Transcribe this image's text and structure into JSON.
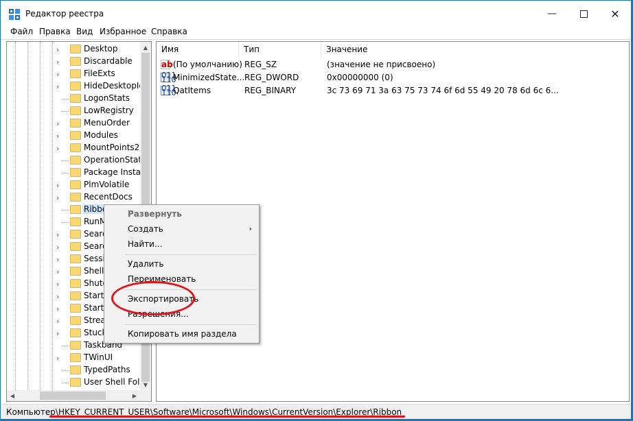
{
  "window": {
    "title": "Редактор реестра"
  },
  "menu": [
    "Файл",
    "Правка",
    "Вид",
    "Избранное",
    "Справка"
  ],
  "tree": {
    "items": [
      {
        "label": "Desktop",
        "expandable": true
      },
      {
        "label": "Discardable",
        "expandable": true
      },
      {
        "label": "FileExts",
        "expandable": true
      },
      {
        "label": "HideDesktopIcc",
        "expandable": true
      },
      {
        "label": "LogonStats",
        "expandable": false
      },
      {
        "label": "LowRegistry",
        "expandable": false
      },
      {
        "label": "MenuOrder",
        "expandable": true
      },
      {
        "label": "Modules",
        "expandable": true
      },
      {
        "label": "MountPoints2",
        "expandable": true
      },
      {
        "label": "OperationStatus",
        "expandable": false
      },
      {
        "label": "Package Installa",
        "expandable": false
      },
      {
        "label": "PlmVolatile",
        "expandable": true
      },
      {
        "label": "RecentDocs",
        "expandable": true
      },
      {
        "label": "Ribbo",
        "expandable": false,
        "selected": true
      },
      {
        "label": "RunM",
        "expandable": false
      },
      {
        "label": "Searc",
        "expandable": true
      },
      {
        "label": "Searc",
        "expandable": true
      },
      {
        "label": "Sessic",
        "expandable": true
      },
      {
        "label": "Shell I",
        "expandable": true
      },
      {
        "label": "Shutd",
        "expandable": true
      },
      {
        "label": "StartP",
        "expandable": true
      },
      {
        "label": "Startu",
        "expandable": true
      },
      {
        "label": "Strear",
        "expandable": true
      },
      {
        "label": "Stuck",
        "expandable": true
      },
      {
        "label": "Taskband",
        "expandable": false
      },
      {
        "label": "TWinUI",
        "expandable": true
      },
      {
        "label": "TypedPaths",
        "expandable": false
      },
      {
        "label": "User Shell Folde",
        "expandable": false
      }
    ]
  },
  "list": {
    "columns": [
      "Имя",
      "Тип",
      "Значение"
    ],
    "rows": [
      {
        "icon": "string-value-icon",
        "name": "(По умолчанию)",
        "type": "REG_SZ",
        "value": "(значение не присвоено)"
      },
      {
        "icon": "binary-value-icon",
        "name": "MinimizedState...",
        "type": "REG_DWORD",
        "value": "0x00000000 (0)"
      },
      {
        "icon": "binary-value-icon",
        "name": "QatItems",
        "type": "REG_BINARY",
        "value": "3c 73 69 71 3a 63 75 73 74 6f 6d 55 49 20 78 6d 6c 6..."
      }
    ]
  },
  "context_menu": {
    "expand": "Развернуть",
    "create": "Создать",
    "find": "Найти...",
    "delete": "Удалить",
    "rename": "Переименовать",
    "export": "Экспортировать",
    "permissions": "Разрешения...",
    "copy_key_name": "Копировать имя раздела"
  },
  "status": {
    "path": "Компьютер\\HKEY_CURRENT_USER\\Software\\Microsoft\\Windows\\CurrentVersion\\Explorer\\Ribbon"
  },
  "colors": {
    "accent": "#1b76b8",
    "annotation": "#e0151b",
    "selection": "#cce8ff",
    "folder": "#f8d775"
  }
}
